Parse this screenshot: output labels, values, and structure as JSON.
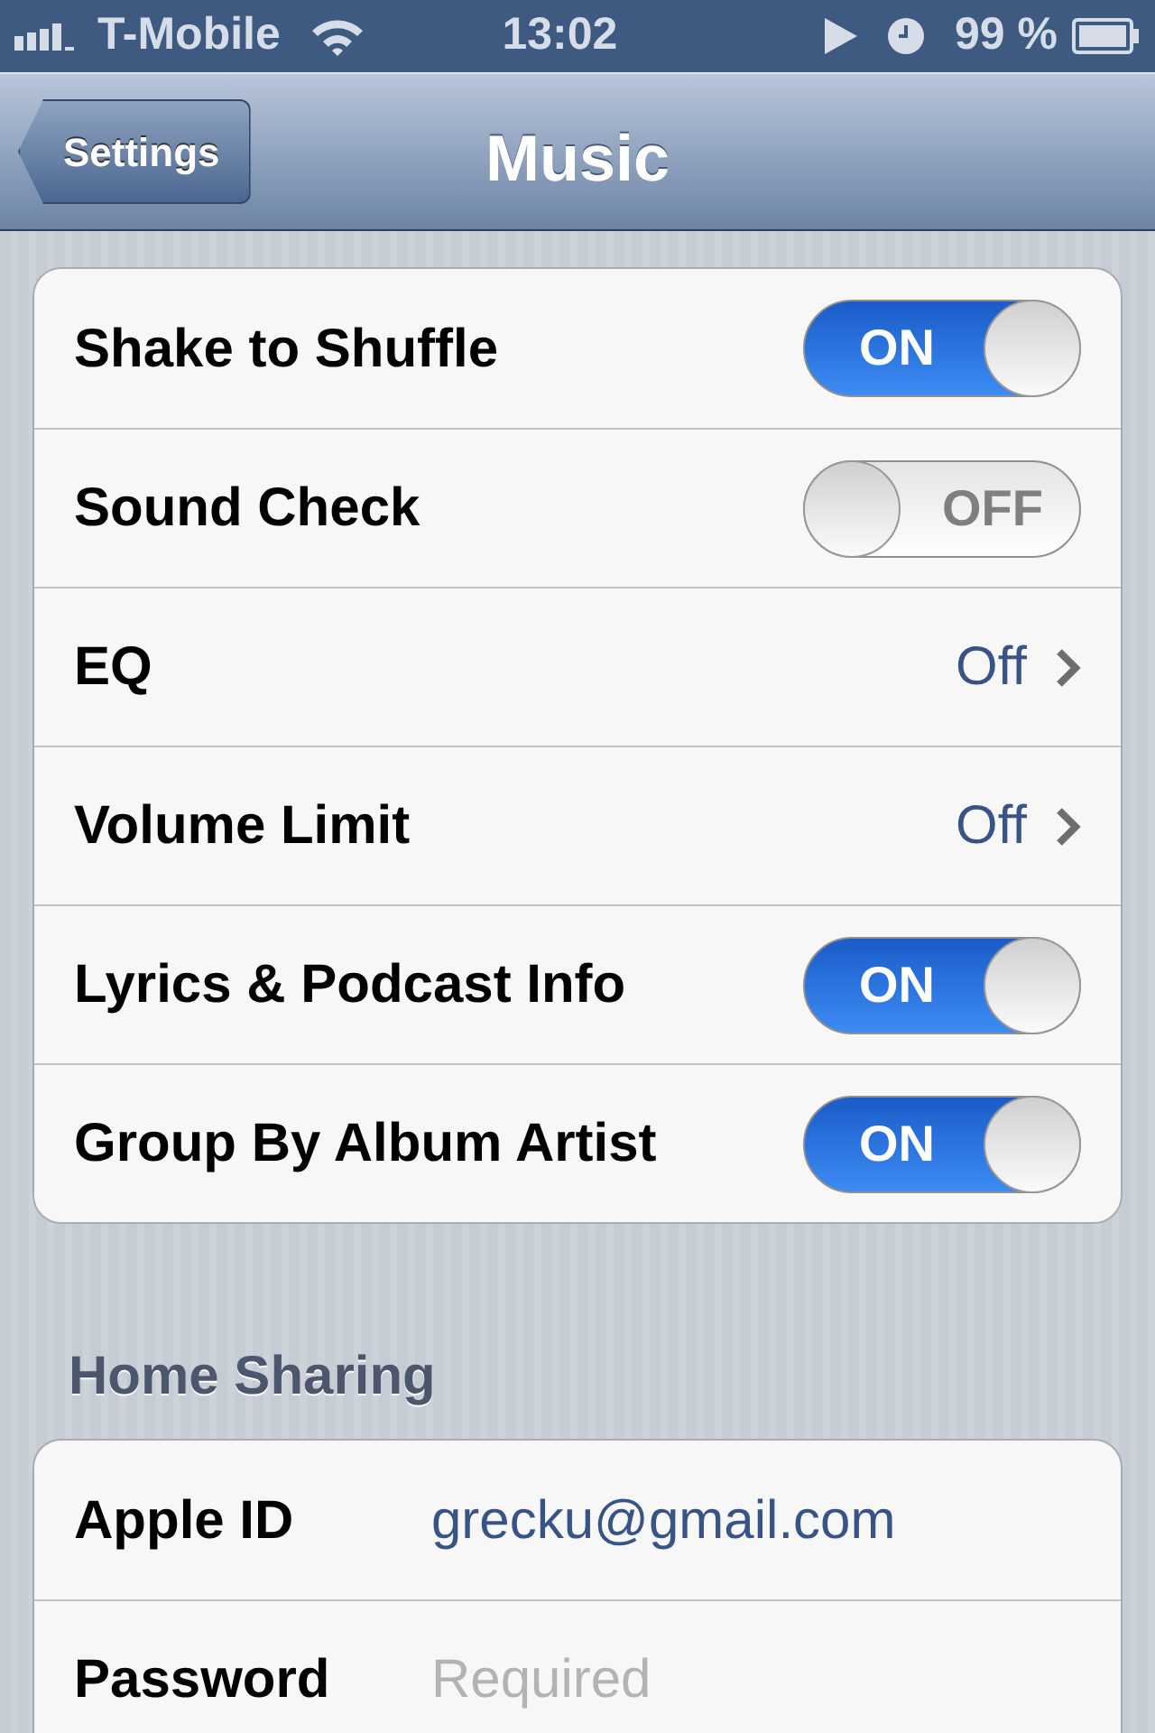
{
  "status_bar": {
    "carrier": "T-Mobile",
    "time": "13:02",
    "battery": "99 %"
  },
  "nav_bar": {
    "back": "Settings",
    "title": "Music"
  },
  "settings": [
    {
      "kind": "toggle",
      "label": "Shake to Shuffle",
      "on": true,
      "switch_label": "ON"
    },
    {
      "kind": "toggle",
      "label": "Sound Check",
      "on": false,
      "switch_label": "OFF"
    },
    {
      "kind": "link",
      "label": "EQ",
      "value": "Off"
    },
    {
      "kind": "link",
      "label": "Volume Limit",
      "value": "Off"
    },
    {
      "kind": "toggle",
      "label": "Lyrics & Podcast Info",
      "on": true,
      "switch_label": "ON"
    },
    {
      "kind": "toggle",
      "label": "Group By Album Artist",
      "on": true,
      "switch_label": "ON"
    }
  ],
  "home_sharing": {
    "header": "Home Sharing",
    "fields": [
      {
        "label": "Apple ID",
        "value": "grecku@gmail.com"
      },
      {
        "label": "Password",
        "placeholder": "Required"
      }
    ]
  }
}
